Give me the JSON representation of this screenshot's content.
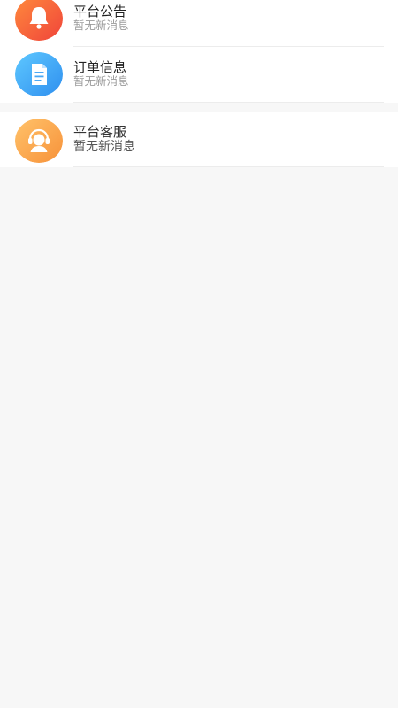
{
  "colors": {
    "page_background": "#f7f7f7",
    "card_background": "#ffffff",
    "announcement_icon_from": "#ff8a3d",
    "announcement_icon_to": "#f0443a",
    "order_icon_from": "#5ec8ff",
    "order_icon_to": "#2f8fef",
    "service_icon_from": "#ffc26a",
    "service_icon_to": "#f7923a"
  },
  "messages": [
    {
      "icon": "bell-icon",
      "title": "平台公告",
      "subtitle": "暂无新消息"
    },
    {
      "icon": "document-icon",
      "title": "订单信息",
      "subtitle": "暂无新消息"
    }
  ],
  "service": {
    "icon": "customer-service-icon",
    "title": "平台客服",
    "subtitle": "暂无新消息"
  }
}
